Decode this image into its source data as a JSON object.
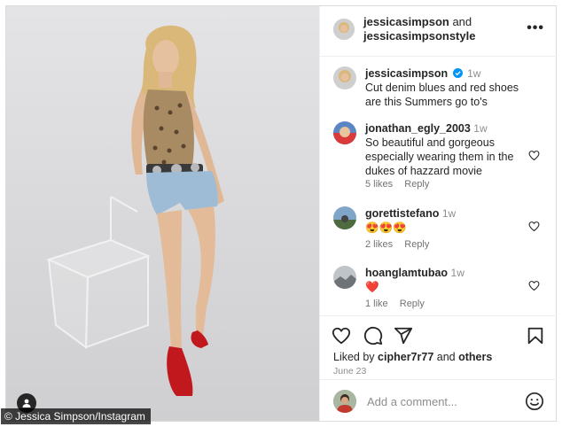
{
  "media": {
    "credit": "© Jessica Simpson/Instagram"
  },
  "header": {
    "user1": "jessicasimpson",
    "and": "and",
    "user2": "jessicasimpsonstyle",
    "more_icon": "more-horizontal-icon"
  },
  "caption": {
    "username": "jessicasimpson",
    "time": "1w",
    "text": "Cut denim blues and red shoes are this Summers go to's"
  },
  "comments": [
    {
      "username": "jonathan_egly_2003",
      "time": "1w",
      "text": "So beautiful and gorgeous especially wearing them in the dukes of hazzard movie",
      "likes": "5 likes",
      "reply": "Reply"
    },
    {
      "username": "gorettistefano",
      "time": "1w",
      "text": "😍😍😍",
      "likes": "2 likes",
      "reply": "Reply"
    },
    {
      "username": "hoanglamtubao",
      "time": "1w",
      "text": "❤️",
      "likes": "1 like",
      "reply": "Reply"
    }
  ],
  "actions": {
    "liked_prefix": "Liked by",
    "liked_user": "cipher7r77",
    "liked_and": "and",
    "liked_others": "others",
    "date": "June 23",
    "icons": [
      "heart-icon",
      "comment-icon",
      "share-icon",
      "bookmark-icon"
    ]
  },
  "add_comment": {
    "placeholder": "Add a comment...",
    "emoji_icon": "smiley-icon"
  },
  "colors": {
    "text": "#262626",
    "muted": "#8e8e8e",
    "verified": "#0095f6",
    "heart_red": "#ed4956"
  }
}
